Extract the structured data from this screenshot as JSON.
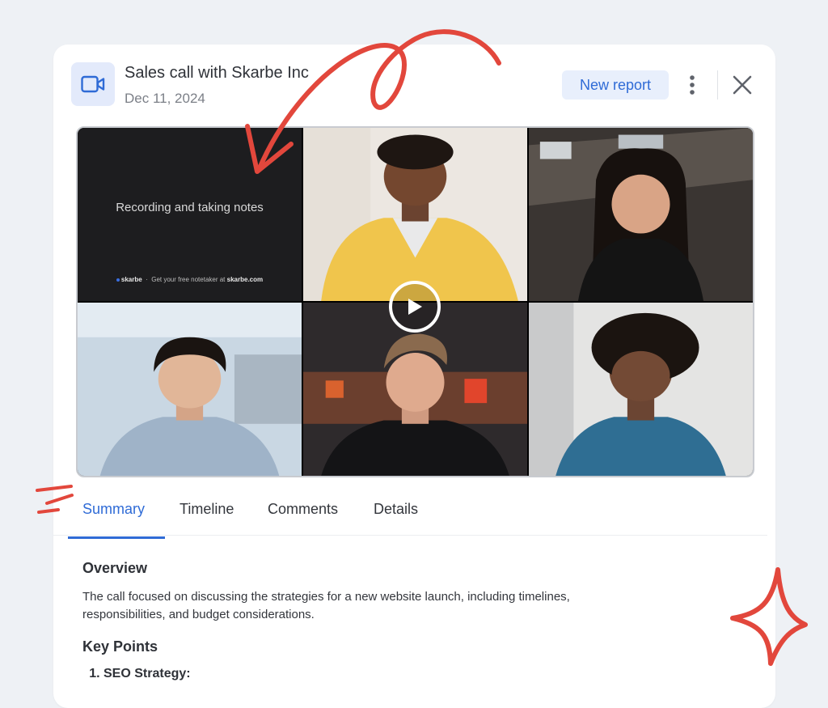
{
  "header": {
    "title": "Sales call with Skarbe Inc",
    "date": "Dec 11, 2024",
    "new_report_label": "New report"
  },
  "video": {
    "slide_text": "Recording and taking notes",
    "footer_brand": "skarbe",
    "footer_text": "Get your free notetaker at",
    "footer_site": "skarbe.com"
  },
  "tabs": [
    {
      "label": "Summary",
      "active": true
    },
    {
      "label": "Timeline",
      "active": false
    },
    {
      "label": "Comments",
      "active": false
    },
    {
      "label": "Details",
      "active": false
    }
  ],
  "summary": {
    "overview_heading": "Overview",
    "overview_text": "The call focused on discussing the strategies for a new website launch, including timelines, responsibilities, and budget considerations.",
    "key_points_heading": "Key Points",
    "key_points": [
      "SEO Strategy:"
    ]
  },
  "colors": {
    "accent": "#2f6bd6",
    "doodle": "#e2473c",
    "background": "#eef1f5"
  },
  "icons": {
    "header": "video-camera-icon",
    "menu": "more-vertical-icon",
    "close": "close-icon",
    "play": "play-icon"
  }
}
